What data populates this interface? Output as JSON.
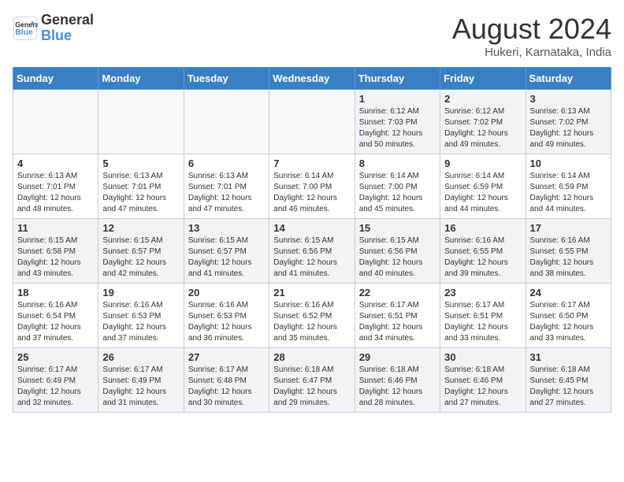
{
  "header": {
    "logo_line1": "General",
    "logo_line2": "Blue",
    "month_year": "August 2024",
    "location": "Hukeri, Karnataka, India"
  },
  "days_of_week": [
    "Sunday",
    "Monday",
    "Tuesday",
    "Wednesday",
    "Thursday",
    "Friday",
    "Saturday"
  ],
  "weeks": [
    [
      {
        "day": "",
        "info": ""
      },
      {
        "day": "",
        "info": ""
      },
      {
        "day": "",
        "info": ""
      },
      {
        "day": "",
        "info": ""
      },
      {
        "day": "1",
        "info": "Sunrise: 6:12 AM\nSunset: 7:03 PM\nDaylight: 12 hours\nand 50 minutes."
      },
      {
        "day": "2",
        "info": "Sunrise: 6:12 AM\nSunset: 7:02 PM\nDaylight: 12 hours\nand 49 minutes."
      },
      {
        "day": "3",
        "info": "Sunrise: 6:13 AM\nSunset: 7:02 PM\nDaylight: 12 hours\nand 49 minutes."
      }
    ],
    [
      {
        "day": "4",
        "info": "Sunrise: 6:13 AM\nSunset: 7:01 PM\nDaylight: 12 hours\nand 48 minutes."
      },
      {
        "day": "5",
        "info": "Sunrise: 6:13 AM\nSunset: 7:01 PM\nDaylight: 12 hours\nand 47 minutes."
      },
      {
        "day": "6",
        "info": "Sunrise: 6:13 AM\nSunset: 7:01 PM\nDaylight: 12 hours\nand 47 minutes."
      },
      {
        "day": "7",
        "info": "Sunrise: 6:14 AM\nSunset: 7:00 PM\nDaylight: 12 hours\nand 46 minutes."
      },
      {
        "day": "8",
        "info": "Sunrise: 6:14 AM\nSunset: 7:00 PM\nDaylight: 12 hours\nand 45 minutes."
      },
      {
        "day": "9",
        "info": "Sunrise: 6:14 AM\nSunset: 6:59 PM\nDaylight: 12 hours\nand 44 minutes."
      },
      {
        "day": "10",
        "info": "Sunrise: 6:14 AM\nSunset: 6:59 PM\nDaylight: 12 hours\nand 44 minutes."
      }
    ],
    [
      {
        "day": "11",
        "info": "Sunrise: 6:15 AM\nSunset: 6:58 PM\nDaylight: 12 hours\nand 43 minutes."
      },
      {
        "day": "12",
        "info": "Sunrise: 6:15 AM\nSunset: 6:57 PM\nDaylight: 12 hours\nand 42 minutes."
      },
      {
        "day": "13",
        "info": "Sunrise: 6:15 AM\nSunset: 6:57 PM\nDaylight: 12 hours\nand 41 minutes."
      },
      {
        "day": "14",
        "info": "Sunrise: 6:15 AM\nSunset: 6:56 PM\nDaylight: 12 hours\nand 41 minutes."
      },
      {
        "day": "15",
        "info": "Sunrise: 6:15 AM\nSunset: 6:56 PM\nDaylight: 12 hours\nand 40 minutes."
      },
      {
        "day": "16",
        "info": "Sunrise: 6:16 AM\nSunset: 6:55 PM\nDaylight: 12 hours\nand 39 minutes."
      },
      {
        "day": "17",
        "info": "Sunrise: 6:16 AM\nSunset: 6:55 PM\nDaylight: 12 hours\nand 38 minutes."
      }
    ],
    [
      {
        "day": "18",
        "info": "Sunrise: 6:16 AM\nSunset: 6:54 PM\nDaylight: 12 hours\nand 37 minutes."
      },
      {
        "day": "19",
        "info": "Sunrise: 6:16 AM\nSunset: 6:53 PM\nDaylight: 12 hours\nand 37 minutes."
      },
      {
        "day": "20",
        "info": "Sunrise: 6:16 AM\nSunset: 6:53 PM\nDaylight: 12 hours\nand 36 minutes."
      },
      {
        "day": "21",
        "info": "Sunrise: 6:16 AM\nSunset: 6:52 PM\nDaylight: 12 hours\nand 35 minutes."
      },
      {
        "day": "22",
        "info": "Sunrise: 6:17 AM\nSunset: 6:51 PM\nDaylight: 12 hours\nand 34 minutes."
      },
      {
        "day": "23",
        "info": "Sunrise: 6:17 AM\nSunset: 6:51 PM\nDaylight: 12 hours\nand 33 minutes."
      },
      {
        "day": "24",
        "info": "Sunrise: 6:17 AM\nSunset: 6:50 PM\nDaylight: 12 hours\nand 33 minutes."
      }
    ],
    [
      {
        "day": "25",
        "info": "Sunrise: 6:17 AM\nSunset: 6:49 PM\nDaylight: 12 hours\nand 32 minutes."
      },
      {
        "day": "26",
        "info": "Sunrise: 6:17 AM\nSunset: 6:49 PM\nDaylight: 12 hours\nand 31 minutes."
      },
      {
        "day": "27",
        "info": "Sunrise: 6:17 AM\nSunset: 6:48 PM\nDaylight: 12 hours\nand 30 minutes."
      },
      {
        "day": "28",
        "info": "Sunrise: 6:18 AM\nSunset: 6:47 PM\nDaylight: 12 hours\nand 29 minutes."
      },
      {
        "day": "29",
        "info": "Sunrise: 6:18 AM\nSunset: 6:46 PM\nDaylight: 12 hours\nand 28 minutes."
      },
      {
        "day": "30",
        "info": "Sunrise: 6:18 AM\nSunset: 6:46 PM\nDaylight: 12 hours\nand 27 minutes."
      },
      {
        "day": "31",
        "info": "Sunrise: 6:18 AM\nSunset: 6:45 PM\nDaylight: 12 hours\nand 27 minutes."
      }
    ]
  ]
}
